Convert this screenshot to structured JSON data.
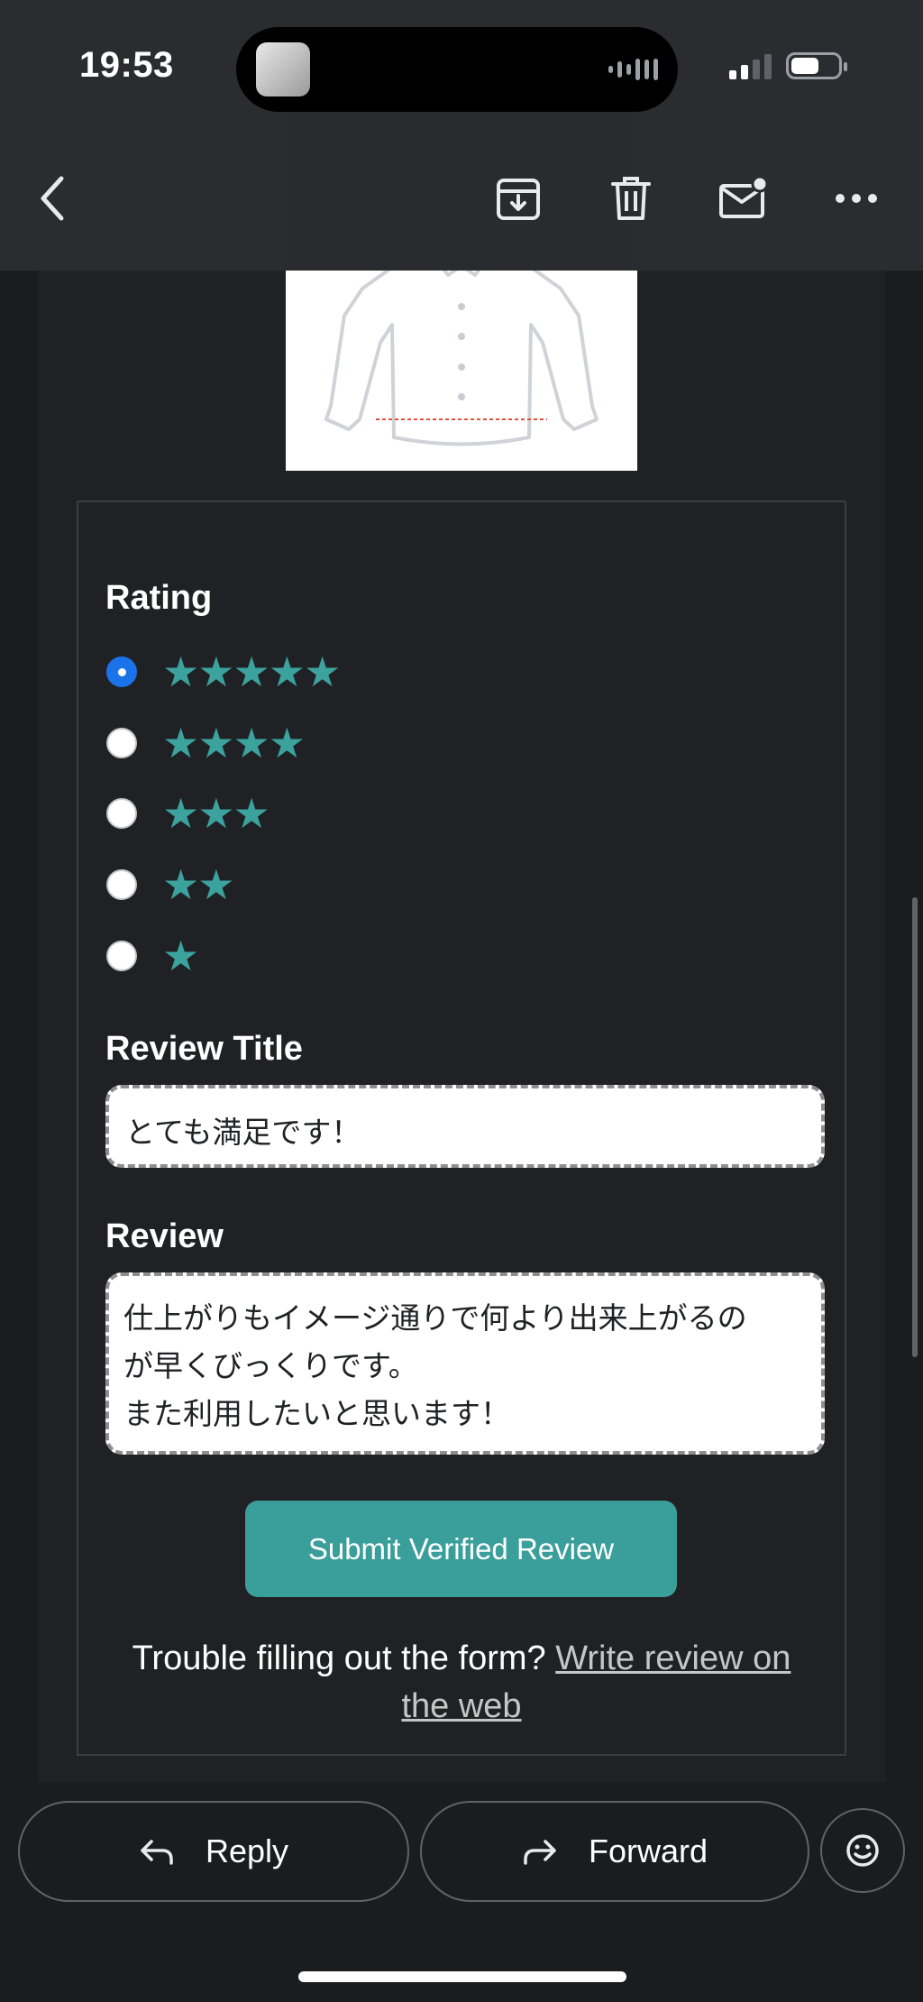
{
  "status_bar": {
    "time": "19:53"
  },
  "toolbar": {
    "back": "back-arrow-icon",
    "archive": "archive-icon",
    "delete": "trash-icon",
    "mark_unread": "mail-unread-icon",
    "more": "more-horizontal-icon"
  },
  "form": {
    "rating_label": "Rating",
    "ratings": [
      {
        "stars": "★★★★★",
        "value": 5,
        "selected": true
      },
      {
        "stars": "★★★★",
        "value": 4,
        "selected": false
      },
      {
        "stars": "★★★",
        "value": 3,
        "selected": false
      },
      {
        "stars": "★★",
        "value": 2,
        "selected": false
      },
      {
        "stars": "★",
        "value": 1,
        "selected": false
      }
    ],
    "review_title_label": "Review Title",
    "review_title_value": "とても満足です！",
    "review_label": "Review",
    "review_value": "仕上がりもイメージ通りで何より出来上がるの\nが早くびっくりです。\nまた利用したいと思います！",
    "submit_label": "Submit Verified Review",
    "trouble_text": "Trouble filling out the form?",
    "web_link": "Write review on the web"
  },
  "bottom_actions": {
    "reply_label": "Reply",
    "forward_label": "Forward"
  },
  "colors": {
    "accent_teal": "#3a9e9a",
    "star_teal": "#3ba29e",
    "radio_selected": "#1a73e8",
    "background": "#202124"
  }
}
